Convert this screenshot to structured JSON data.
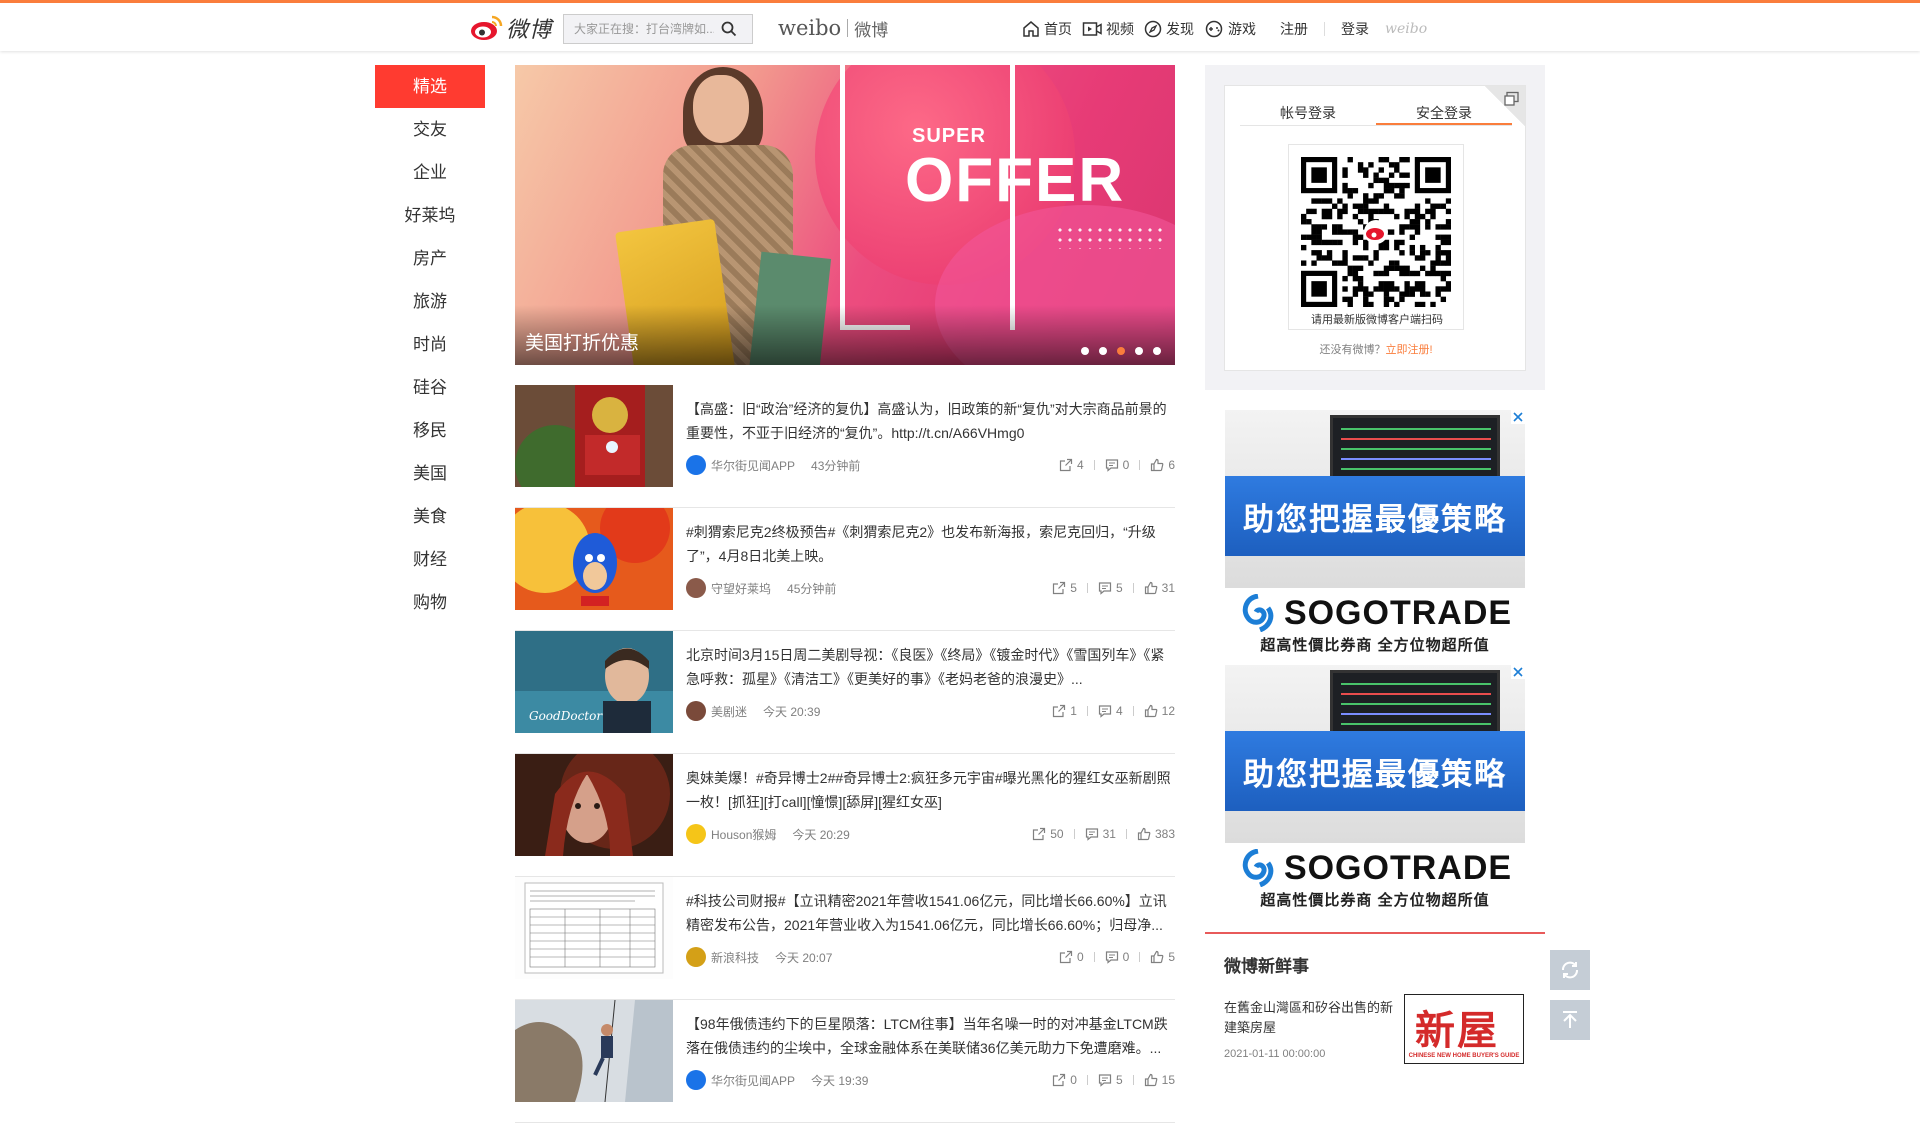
{
  "header": {
    "logo_text": "微博",
    "search": {
      "placeholder": "大家正在搜：打台湾牌如..."
    },
    "brand_en": "weibo",
    "brand_cn": "微博",
    "nav": [
      {
        "label": "首页",
        "icon": "home-icon"
      },
      {
        "label": "视频",
        "icon": "video-icon"
      },
      {
        "label": "发现",
        "icon": "discover-icon"
      },
      {
        "label": "游戏",
        "icon": "gamepad-icon"
      }
    ],
    "register": "注册",
    "login": "登录",
    "brand_small": "weibo"
  },
  "left_nav": {
    "items": [
      "精选",
      "交友",
      "企业",
      "好莱坞",
      "房产",
      "旅游",
      "时尚",
      "硅谷",
      "移民",
      "美国",
      "美食",
      "财经",
      "购物"
    ],
    "active_index": 0
  },
  "banner": {
    "super": "SUPER",
    "offer": "OFFER",
    "caption": "美国打折优惠",
    "dot_count": 5,
    "active_dot": 2
  },
  "feed": [
    {
      "text": "【高盛：旧“政治”经济的复仇】高盛认为，旧政策的新“复仇”对大宗商品前景的重要性，不亚于旧经济的“复仇”。http://t.cn/A66VHmg0",
      "source": "华尔街见闻APP",
      "time": "43分钟前",
      "reposts": "4",
      "comments": "0",
      "likes": "6",
      "thumb": "ironman",
      "avatar_color": "#1a73e8"
    },
    {
      "text": "#刺猬索尼克2终极预告#《刺猬索尼克2》也发布新海报，索尼克回归，“升级了”，4月8日北美上映。",
      "source": "守望好莱坞",
      "time": "45分钟前",
      "reposts": "5",
      "comments": "5",
      "likes": "31",
      "thumb": "sonic",
      "avatar_color": "#8a5a4a"
    },
    {
      "text": "北京时间3月15日周二美剧导视：《良医》《终局》《镀金时代》《雪国列车》《紧急呼救：孤星》《清洁工》《更美好的事》《老妈老爸的浪漫史》...",
      "source": "美剧迷",
      "time": "今天 20:39",
      "reposts": "1",
      "comments": "4",
      "likes": "12",
      "thumb": "gooddoctor",
      "thumb_label": "GoodDoctor",
      "avatar_color": "#7a4a3a"
    },
    {
      "text": "奥妹美爆！#奇异博士2##奇异博士2:疯狂多元宇宙#曝光黑化的猩红女巫新剧照一枚！[抓狂][打call][憧憬][舔屏][猩红女巫]",
      "source": "Houson猴姆",
      "time": "今天 20:29",
      "reposts": "50",
      "comments": "31",
      "likes": "383",
      "thumb": "wanda",
      "avatar_color": "#f5c518"
    },
    {
      "text": "#科技公司财报#【立讯精密2021年营收1541.06亿元，同比增长66.60%】立讯精密发布公告，2021年营业收入为1541.06亿元，同比增长66.60%；归母净...",
      "source": "新浪科技",
      "time": "今天 20:07",
      "reposts": "0",
      "comments": "0",
      "likes": "5",
      "thumb": "report",
      "avatar_color": "#d4a017"
    },
    {
      "text": "【98年俄债违约下的巨星陨落：LTCM往事】当年名噪一时的对冲基金LTCM跌落在俄债违约的尘埃中，全球金融体系在美联储36亿美元助力下免遭磨难。...",
      "source": "华尔街见闻APP",
      "time": "今天 19:39",
      "reposts": "0",
      "comments": "5",
      "likes": "15",
      "thumb": "climber",
      "avatar_color": "#1a73e8"
    }
  ],
  "login": {
    "tab_account": "帐号登录",
    "tab_secure": "安全登录",
    "qr_caption": "请用最新版微博客户端扫码",
    "no_account": "还没有微博？",
    "register_link": "立即注册!"
  },
  "ads": [
    {
      "headline": "助您把握最優策略",
      "brand": "SOGOTRADE",
      "sub": "超高性價比券商 全方位物超所值"
    },
    {
      "headline": "助您把握最優策略",
      "brand": "SOGOTRADE",
      "sub": "超高性價比券商 全方位物超所值"
    }
  ],
  "news": {
    "title": "微博新鲜事",
    "text": "在舊金山灣區和矽谷出售的新建築房屋",
    "time": "2021-01-11 00:00:00",
    "img_big": "新屋",
    "img_small": "CHINESE NEW HOME BUYER'S GUIDE"
  },
  "colors": {
    "accent": "#fa7d3c",
    "active_nav": "#ff3b30",
    "ad_blue": "#2f7be0"
  }
}
